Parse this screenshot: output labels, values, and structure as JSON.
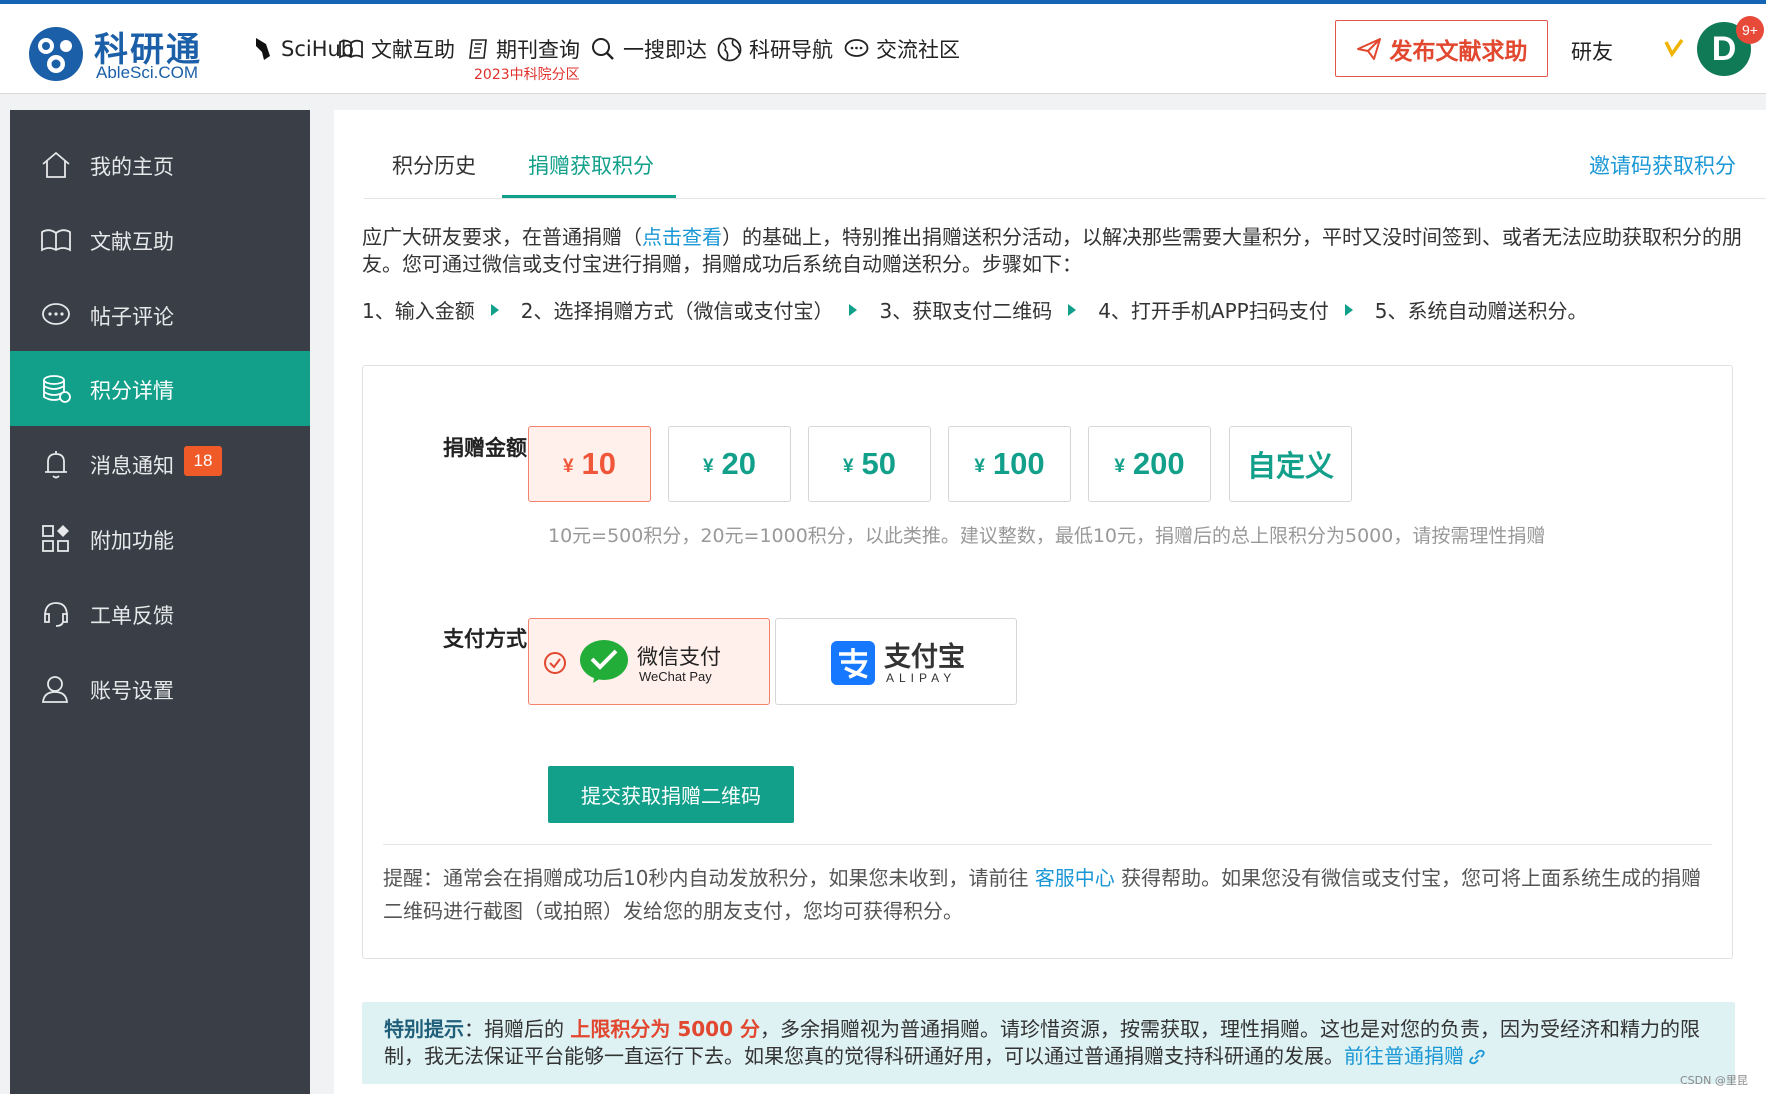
{
  "header": {
    "logo_cn": "科研通",
    "logo_en": "AbleSci.COM",
    "nav": [
      {
        "icon": "raven-icon",
        "label": "SciHub"
      },
      {
        "icon": "book-icon",
        "label": "文献互助"
      },
      {
        "icon": "journal-icon",
        "label": "期刊查询",
        "sub": "2023中科院分区"
      },
      {
        "icon": "search-icon",
        "label": "一搜即达"
      },
      {
        "icon": "globe-icon",
        "label": "科研导航"
      },
      {
        "icon": "chat-icon",
        "label": "交流社区"
      }
    ],
    "publish_button": "发布文献求助",
    "user_label": "研友",
    "avatar_letter": "D",
    "avatar_badge": "9+"
  },
  "sidebar": {
    "items": [
      {
        "label": "我的主页",
        "icon": "home-icon"
      },
      {
        "label": "文献互助",
        "icon": "book-icon"
      },
      {
        "label": "帖子评论",
        "icon": "comment-icon"
      },
      {
        "label": "积分详情",
        "icon": "database-icon",
        "active": true
      },
      {
        "label": "消息通知",
        "icon": "bell-icon",
        "badge": "18"
      },
      {
        "label": "附加功能",
        "icon": "apps-icon"
      },
      {
        "label": "工单反馈",
        "icon": "headset-icon"
      },
      {
        "label": "账号设置",
        "icon": "user-icon"
      }
    ]
  },
  "tabs": [
    {
      "label": "积分历史",
      "active": false
    },
    {
      "label": "捐赠获取积分",
      "active": true
    }
  ],
  "invite_link": "邀请码获取积分",
  "intro": {
    "part1": "应广大研友要求，在普通捐赠（",
    "link": "点击查看",
    "part2": "）的基础上，特别推出捐赠送积分活动，以解决那些需要大量积分，平时又没时间签到、或者无法应助获取积分的朋友。您可通过微信或支付宝进行捐赠，捐赠成功后系统自动赠送积分。步骤如下："
  },
  "steps": [
    "1、输入金额",
    "2、选择捐赠方式（微信或支付宝）",
    "3、获取支付二维码",
    "4、打开手机APP扫码支付",
    "5、系统自动赠送积分。"
  ],
  "donation": {
    "amount_label": "捐赠金额",
    "currency": "¥",
    "amounts": [
      "10",
      "20",
      "50",
      "100",
      "200"
    ],
    "selected_amount": "10",
    "custom_label": "自定义",
    "hint": "10元=500积分，20元=1000积分，以此类推。建议整数，最低10元，捐赠后的总上限积分为5000，请按需理性捐赠",
    "payment_label": "支付方式",
    "wechat_cn": "微信支付",
    "wechat_en": "WeChat Pay",
    "alipay_cn": "支付宝",
    "alipay_en": "ALIPAY",
    "selected_payment": "wechat",
    "submit": "提交获取捐赠二维码",
    "reminder_part1": "提醒：通常会在捐赠成功后10秒内自动发放积分，如果您未收到，请前往 ",
    "reminder_link": "客服中心",
    "reminder_part2": " 获得帮助。如果您没有微信或支付宝，您可将上面系统生成的捐赠二维码进行截图（或拍照）发给您的朋友支付，您均可获得积分。"
  },
  "notice": {
    "title": "特别提示",
    "colon": "：",
    "part1": "捐赠后的 ",
    "highlight": "上限积分为 5000 分",
    "part2": "，多余捐赠视为普通捐赠。请珍惜资源，按需获取，理性捐赠。这也是对您的负责，因为受经济和精力的限制，我无法保证平台能够一直运行下去。如果您真的觉得科研通好用，可以通过普通捐赠支持科研通的发展。",
    "link": "前往普通捐赠"
  },
  "watermark": "CSDN @里昆",
  "colors": {
    "accent": "#13a08b",
    "danger": "#e2472f",
    "link": "#1a97d5",
    "sidebar": "#3a3f47"
  }
}
